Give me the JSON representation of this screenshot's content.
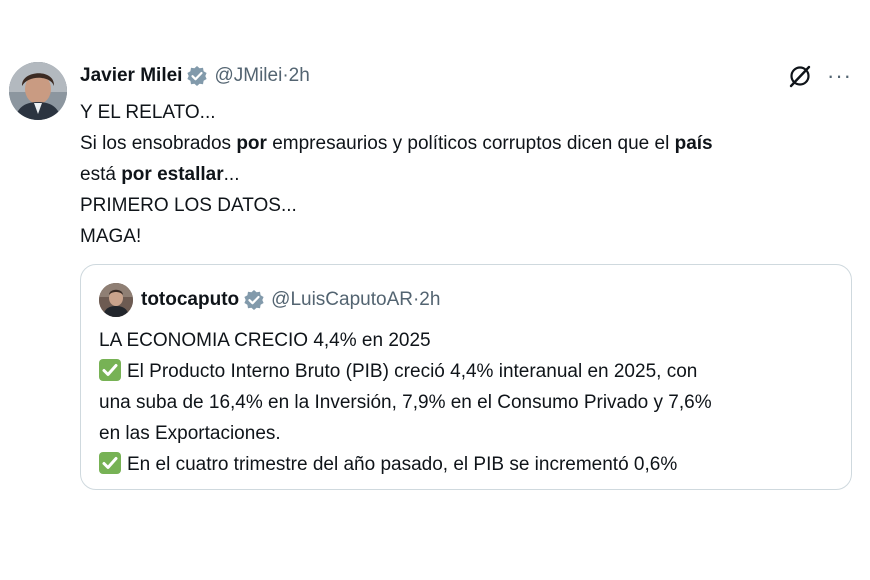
{
  "tweet": {
    "author_name": "Javier Milei",
    "handle": "@JMilei",
    "separator": " · ",
    "time": "2h",
    "more_label": "···",
    "lines": [
      {
        "segments": [
          {
            "text": "Y EL RELATO...",
            "bold": false
          }
        ]
      },
      {
        "segments": [
          {
            "text": "Si los ensobrados ",
            "bold": false
          },
          {
            "text": "por",
            "bold": true
          },
          {
            "text": " empresaurios y políticos corruptos dicen que el ",
            "bold": false
          },
          {
            "text": "país",
            "bold": true
          }
        ]
      },
      {
        "segments": [
          {
            "text": "está ",
            "bold": false
          },
          {
            "text": "por estallar",
            "bold": true
          },
          {
            "text": "...",
            "bold": false
          }
        ]
      },
      {
        "segments": [
          {
            "text": "PRIMERO LOS DATOS...",
            "bold": false
          }
        ]
      },
      {
        "segments": [
          {
            "text": "MAGA!",
            "bold": false
          }
        ]
      }
    ]
  },
  "quote": {
    "author_name": "totocaputo",
    "handle": "@LuisCaputoAR",
    "separator": " · ",
    "time": "2h",
    "headline": "LA ECONOMIA CRECIO 4,4% en 2025",
    "bullet1_lines": [
      "El Producto Interno Bruto (PIB) creció 4,4% interanual en 2025, con",
      "una suba de 16,4% en la Inversión, 7,9% en el Consumo Privado y 7,6%",
      "en las Exportaciones."
    ],
    "bullet2": "En el cuatro trimestre del año pasado, el PIB se incrementó 0,6%"
  },
  "colors": {
    "verified": "#829aab",
    "check_emoji": "#77b255",
    "border": "#cfd9de",
    "meta_text": "#536471"
  }
}
